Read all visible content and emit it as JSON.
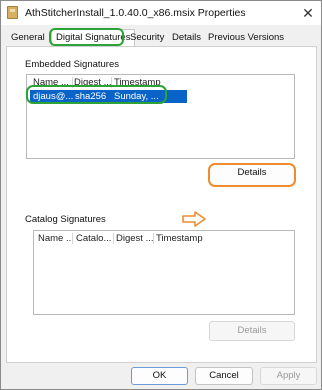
{
  "window": {
    "title": "AthStitcherInstall_1.0.40.0_x86.msix Properties",
    "close_glyph": "✕",
    "icon": "package-icon"
  },
  "tabs": [
    {
      "label": "General"
    },
    {
      "label": "Digital Signatures",
      "active": true
    },
    {
      "label": "Security"
    },
    {
      "label": "Details"
    },
    {
      "label": "Previous Versions"
    }
  ],
  "embedded": {
    "label": "Embedded Signatures",
    "columns": [
      "Name ...",
      "Digest ...",
      "Timestamp"
    ],
    "rows": [
      {
        "name": "djaus@...",
        "digest": "sha256",
        "timestamp": "Sunday, ..."
      }
    ],
    "details_label": "Details"
  },
  "catalog": {
    "label": "Catalog Signatures",
    "columns": [
      "Name ...",
      "Catalo...",
      "Digest ...",
      "Timestamp"
    ],
    "details_label": "Details"
  },
  "footer": {
    "ok": "OK",
    "cancel": "Cancel",
    "apply": "Apply"
  },
  "colors": {
    "selection": "#0a64c8",
    "annotation_green": "#2da337",
    "annotation_orange": "#ef8b30"
  }
}
